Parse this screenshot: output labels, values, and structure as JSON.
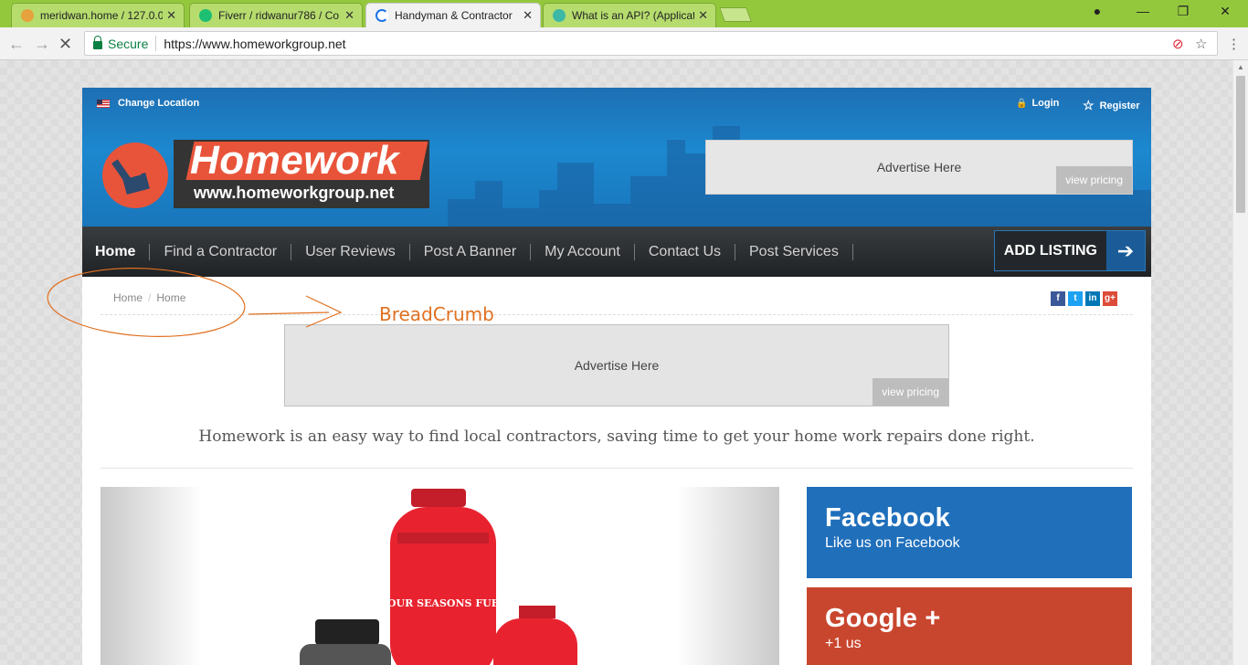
{
  "browser": {
    "tabs": [
      {
        "label": "meridwan.home / 127.0.0",
        "favicon_color": "#e6a23c"
      },
      {
        "label": "Fiverr / ridwanur786 / Co",
        "favicon_color": "#1dbf73"
      },
      {
        "label": "Handyman & Contractor",
        "favicon_color": "#1a73e8"
      },
      {
        "label": "What is an API? (Applicat",
        "favicon_color": "#3db8a7"
      }
    ],
    "tab_close": "✕",
    "secure_label": "Secure",
    "url": "https://www.homeworkgroup.net",
    "nav_back": "←",
    "nav_forward": "→",
    "nav_stop": "✕",
    "window_min": "—",
    "window_restore": "❐",
    "window_close": "✕",
    "profile_icon": "●",
    "star_icon": "☆",
    "menu_icon": "⋮",
    "scroll_up": "▲"
  },
  "header": {
    "change_location": "Change Location",
    "login": "Login",
    "register": "Register",
    "login_icon": "🔒",
    "register_icon": "☆",
    "logo_word": "Homework",
    "logo_url": "www.homeworkgroup.net",
    "ad_text": "Advertise Here",
    "ad_pricing": "view pricing",
    "accent_color": "#1c88cf",
    "logo_color": "#e8543a"
  },
  "nav": {
    "items": [
      "Home",
      "Find a Contractor",
      "User Reviews",
      "Post A Banner",
      "My Account",
      "Contact Us",
      "Post Services"
    ],
    "add_listing": "ADD LISTING",
    "add_listing_arrow": "➔"
  },
  "content": {
    "breadcrumb": [
      "Home",
      "Home"
    ],
    "social": [
      {
        "label": "f",
        "color": "#3b5998",
        "icon": "facebook-icon"
      },
      {
        "label": "t",
        "color": "#1da1f2",
        "icon": "twitter-icon"
      },
      {
        "label": "in",
        "color": "#0077b5",
        "icon": "linkedin-icon"
      },
      {
        "label": "g+",
        "color": "#dd4b39",
        "icon": "google-plus-icon"
      }
    ],
    "ad_text": "Advertise Here",
    "ad_pricing": "view pricing",
    "tagline": "Homework is an easy way to find local contractors, saving time to get your home work repairs done right.",
    "cylinder_label": "FOUR SEASONS FUEL",
    "facebook": {
      "title": "Facebook",
      "subtitle": "Like us on Facebook",
      "color": "#1f6fbb"
    },
    "google": {
      "title": "Google +",
      "subtitle": "+1 us",
      "color": "#c9462e"
    }
  },
  "annotation": {
    "label": "BreadCrumb",
    "color": "#e07020"
  }
}
